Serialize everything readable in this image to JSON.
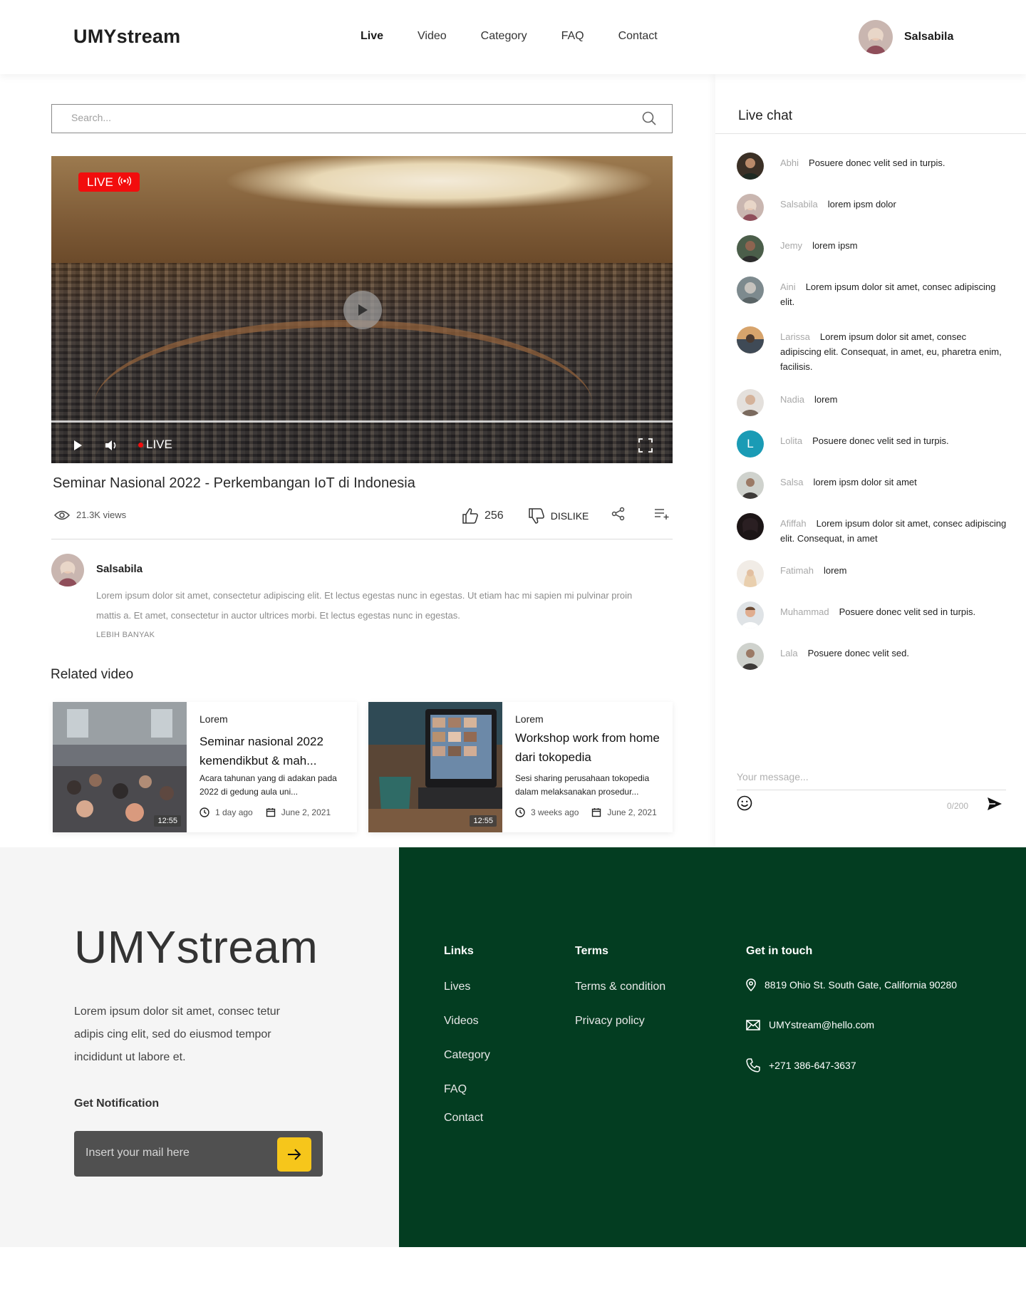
{
  "header": {
    "logo": "UMYstream",
    "nav": [
      {
        "label": "Live",
        "active": true
      },
      {
        "label": "Video",
        "active": false
      },
      {
        "label": "Category",
        "active": false
      },
      {
        "label": "FAQ",
        "active": false
      },
      {
        "label": "Contact",
        "active": false
      }
    ],
    "user_name": "Salsabila"
  },
  "search": {
    "placeholder": "Search..."
  },
  "player": {
    "badge": "LIVE",
    "controls_live_label": "LIVE"
  },
  "video": {
    "title": "Seminar Nasional 2022 - Perkembangan IoT di Indonesia",
    "views": "21.3K views",
    "likes": "256",
    "dislike_label": "DISLIKE"
  },
  "author": {
    "name": "Salsabila",
    "description": "Lorem ipsum dolor sit amet, consectetur adipiscing elit. Et lectus egestas nunc in egestas. Ut etiam hac mi sapien mi pulvinar proin mattis a. Et amet, consectetur in auctor ultrices morbi. Et lectus egestas nunc in egestas.",
    "more_label": "LEBIH BANYAK"
  },
  "related": {
    "title": "Related video",
    "cards": [
      {
        "category": "Lorem",
        "title": "Seminar nasional 2022 kemendikbut & mah...",
        "description": "Acara tahunan yang di adakan pada 2022 di gedung aula uni...",
        "duration": "12:55",
        "ago": "1 day ago",
        "date": "June 2, 2021"
      },
      {
        "category": "Lorem",
        "title": "Workshop work from home dari tokopedia",
        "description": "Sesi sharing perusahaan tokopedia dalam melaksanakan prosedur...",
        "duration": "12:55",
        "ago": "3 weeks ago",
        "date": "June 2, 2021"
      }
    ]
  },
  "chat": {
    "title": "Live chat",
    "messages": [
      {
        "user": "Abhi",
        "text": "Posuere donec velit sed in turpis."
      },
      {
        "user": "Salsabila",
        "text": "lorem ipsm dolor"
      },
      {
        "user": "Jemy",
        "text": "lorem ipsm"
      },
      {
        "user": "Aini",
        "text": "Lorem ipsum dolor sit amet, consec adipiscing elit."
      },
      {
        "user": "Larissa",
        "text": "Lorem ipsum dolor sit amet, consec adipiscing elit. Consequat, in amet, eu, pharetra enim, facilisis."
      },
      {
        "user": "Nadia",
        "text": "lorem"
      },
      {
        "user": "Lolita",
        "text": "Posuere donec velit sed in turpis.",
        "initial": "L"
      },
      {
        "user": "Salsa",
        "text": "lorem ipsm dolor sit amet"
      },
      {
        "user": "Afiffah",
        "text": "Lorem ipsum dolor sit amet, consec adipiscing elit. Consequat, in amet"
      },
      {
        "user": "Fatimah",
        "text": "lorem"
      },
      {
        "user": "Muhammad",
        "text": "Posuere donec velit sed in turpis."
      },
      {
        "user": "Lala",
        "text": "Posuere donec velit sed."
      }
    ],
    "input_placeholder": "Your message...",
    "counter": "0/200"
  },
  "footer": {
    "logo": "UMYstream",
    "description": "Lorem ipsum dolor sit amet, consec tetur adipis cing elit, sed do eiusmod tempor incididunt ut labore et.",
    "notification_title": "Get Notification",
    "mail_placeholder": "Insert your mail here",
    "links_title": "Links",
    "links": [
      "Lives",
      "Videos",
      "Category",
      "FAQ",
      "Contact"
    ],
    "terms_title": "Terms",
    "terms": [
      "Terms & condition",
      "Privacy policy"
    ],
    "contact_title": "Get in touch",
    "address": "8819 Ohio St. South Gate, California 90280",
    "email": "UMYstream@hello.com",
    "phone": "+271 386-647-3637"
  },
  "colors": {
    "live_red": "#f20d0d",
    "footer_green": "#033d21",
    "accent_yellow": "#f6c61b",
    "lolita_avatar": "#1a9bb5"
  }
}
